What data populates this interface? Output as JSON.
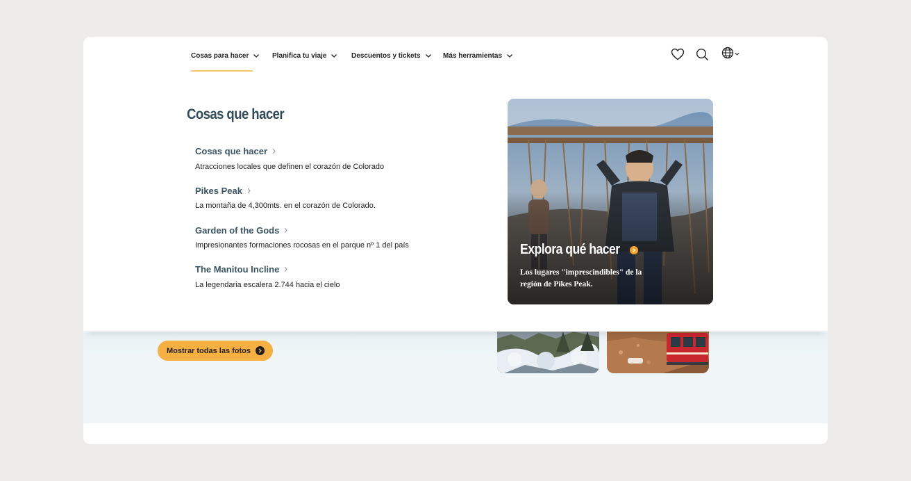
{
  "nav": {
    "items": [
      {
        "label": "Cosas para hacer"
      },
      {
        "label": "Planifica tu viaje"
      },
      {
        "label": "Descuentos y tickets"
      },
      {
        "label": "Más herramientas"
      }
    ],
    "icons": [
      "heart-icon",
      "search-icon",
      "globe-icon"
    ]
  },
  "mega_menu": {
    "title": "Cosas que hacer",
    "links": [
      {
        "label": "Cosas que hacer",
        "description": "Atracciones locales que definen el corazón de Colorado"
      },
      {
        "label": "Pikes Peak",
        "description": "La montaña de 4,300mts. en el corazón de Colorado."
      },
      {
        "label": "Garden of the Gods",
        "description": "Impresionantes formaciones rocosas en el parque nº 1 del país"
      },
      {
        "label": "The Manitou Incline",
        "description": "La legendaria escalera 2.744 hacia el cielo"
      }
    ],
    "feature": {
      "title": "Explora qué hacer",
      "description": "Los lugares \"imprescindibles\" de la región de Pikes Peak."
    }
  },
  "page": {
    "show_photos_label": "Mostrar todas las fotos"
  },
  "colors": {
    "accent": "#f6b041",
    "heading": "#2f4a58",
    "link": "#3b5563",
    "underline": "#f5c86a",
    "background": "#edecea"
  }
}
